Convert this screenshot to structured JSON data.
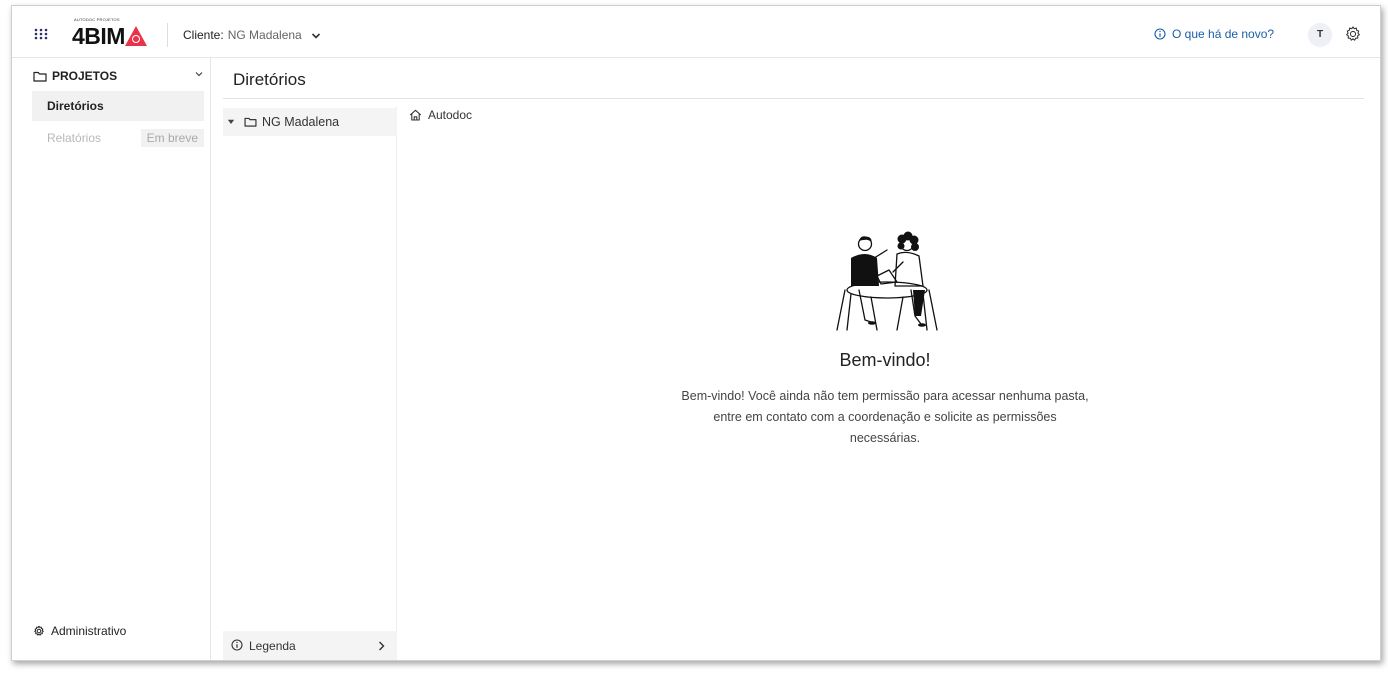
{
  "header": {
    "logo_text": "4BIM",
    "logo_tagline": "AUTODOC PROJETOS",
    "client_label": "Cliente:",
    "client_value": "NG Madalena",
    "whats_new": "O que há de novo?",
    "user_initial": "T"
  },
  "sidebar": {
    "section_title": "PROJETOS",
    "items": [
      {
        "label": "Diretórios",
        "state": "active"
      },
      {
        "label": "Relatórios",
        "state": "disabled",
        "badge": "Em breve"
      }
    ],
    "footer_label": "Administrativo"
  },
  "main": {
    "title": "Diretórios",
    "tree": {
      "root_label": "NG Madalena"
    },
    "legend_label": "Legenda",
    "breadcrumb": "Autodoc",
    "welcome": {
      "title": "Bem-vindo!",
      "message": "Bem-vindo! Você ainda não tem permissão para acessar nenhuma pasta, entre em contato com a coordenação e solicite as permissões necessárias."
    }
  },
  "colors": {
    "accent_link": "#1a5ea8",
    "logo_red": "#e8334a",
    "active_bg": "#f1f1f1"
  },
  "icons": [
    "apps-grid-icon",
    "folder-icon",
    "chevron-down-icon",
    "info-icon",
    "gear-icon",
    "home-icon",
    "chevron-right-icon"
  ]
}
